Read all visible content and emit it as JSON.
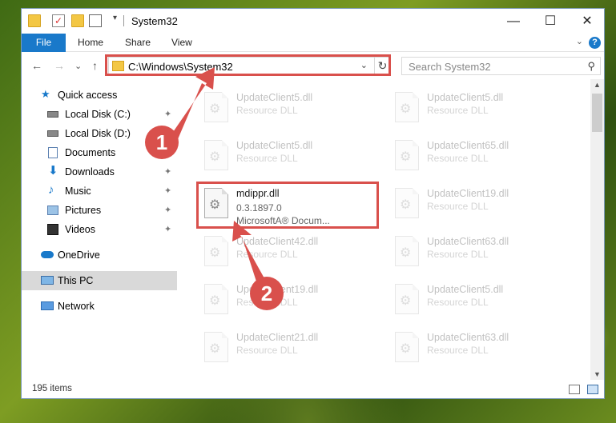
{
  "window": {
    "title": "System32",
    "minimize": "—",
    "maximize": "☐",
    "close": "✕"
  },
  "ribbon": {
    "file": "File",
    "tabs": [
      "Home",
      "Share",
      "View"
    ],
    "help": "?",
    "collapse": "⌄"
  },
  "address": {
    "back": "←",
    "forward": "→",
    "recent": "⌄",
    "up": "↑",
    "path": "C:\\Windows\\System32",
    "dropdown": "⌄",
    "refresh": "↻",
    "search_placeholder": "Search System32",
    "search_icon": "⚲"
  },
  "nav": {
    "items": [
      {
        "label": "Quick access",
        "icon": "star-icon"
      },
      {
        "label": "Local Disk (C:)",
        "icon": "drive-icon",
        "pinned": true
      },
      {
        "label": "Local Disk (D:)",
        "icon": "drive-icon"
      },
      {
        "label": "Documents",
        "icon": "documents-icon",
        "pinned": true
      },
      {
        "label": "Downloads",
        "icon": "download-icon",
        "pinned": true
      },
      {
        "label": "Music",
        "icon": "music-icon",
        "pinned": true
      },
      {
        "label": "Pictures",
        "icon": "pictures-icon",
        "pinned": true
      },
      {
        "label": "Videos",
        "icon": "videos-icon",
        "pinned": true
      },
      {
        "label": "OneDrive",
        "icon": "cloud-icon"
      },
      {
        "label": "This PC",
        "icon": "computer-icon",
        "selected": true
      },
      {
        "label": "Network",
        "icon": "network-icon"
      }
    ],
    "pin_glyph": "📌"
  },
  "files": {
    "left": [
      {
        "name": "UpdateClient5.dll",
        "sub": "Resource DLL"
      },
      {
        "name": "UpdateClient5.dll",
        "sub": "Resource DLL"
      },
      {
        "name": "mdippr.dll",
        "version": "0.3.1897.0",
        "desc": "MicrosoftA® Docum..."
      },
      {
        "name": "UpdateClient42.dll",
        "sub": "Resource DLL"
      },
      {
        "name": "UpdateClient19.dll",
        "sub": "Resource DLL"
      },
      {
        "name": "UpdateClient21.dll",
        "sub": "Resource DLL"
      }
    ],
    "right": [
      {
        "name": "UpdateClient5.dll",
        "sub": "Resource DLL"
      },
      {
        "name": "UpdateClient65.dll",
        "sub": "Resource DLL"
      },
      {
        "name": "UpdateClient19.dll",
        "sub": "Resource DLL"
      },
      {
        "name": "UpdateClient63.dll",
        "sub": "Resource DLL"
      },
      {
        "name": "UpdateClient5.dll",
        "sub": "Resource DLL"
      },
      {
        "name": "UpdateClient63.dll",
        "sub": "Resource DLL"
      }
    ]
  },
  "status": {
    "count": "195 items"
  },
  "annotations": {
    "step1": "1",
    "step2": "2",
    "color": "#d9504c"
  }
}
